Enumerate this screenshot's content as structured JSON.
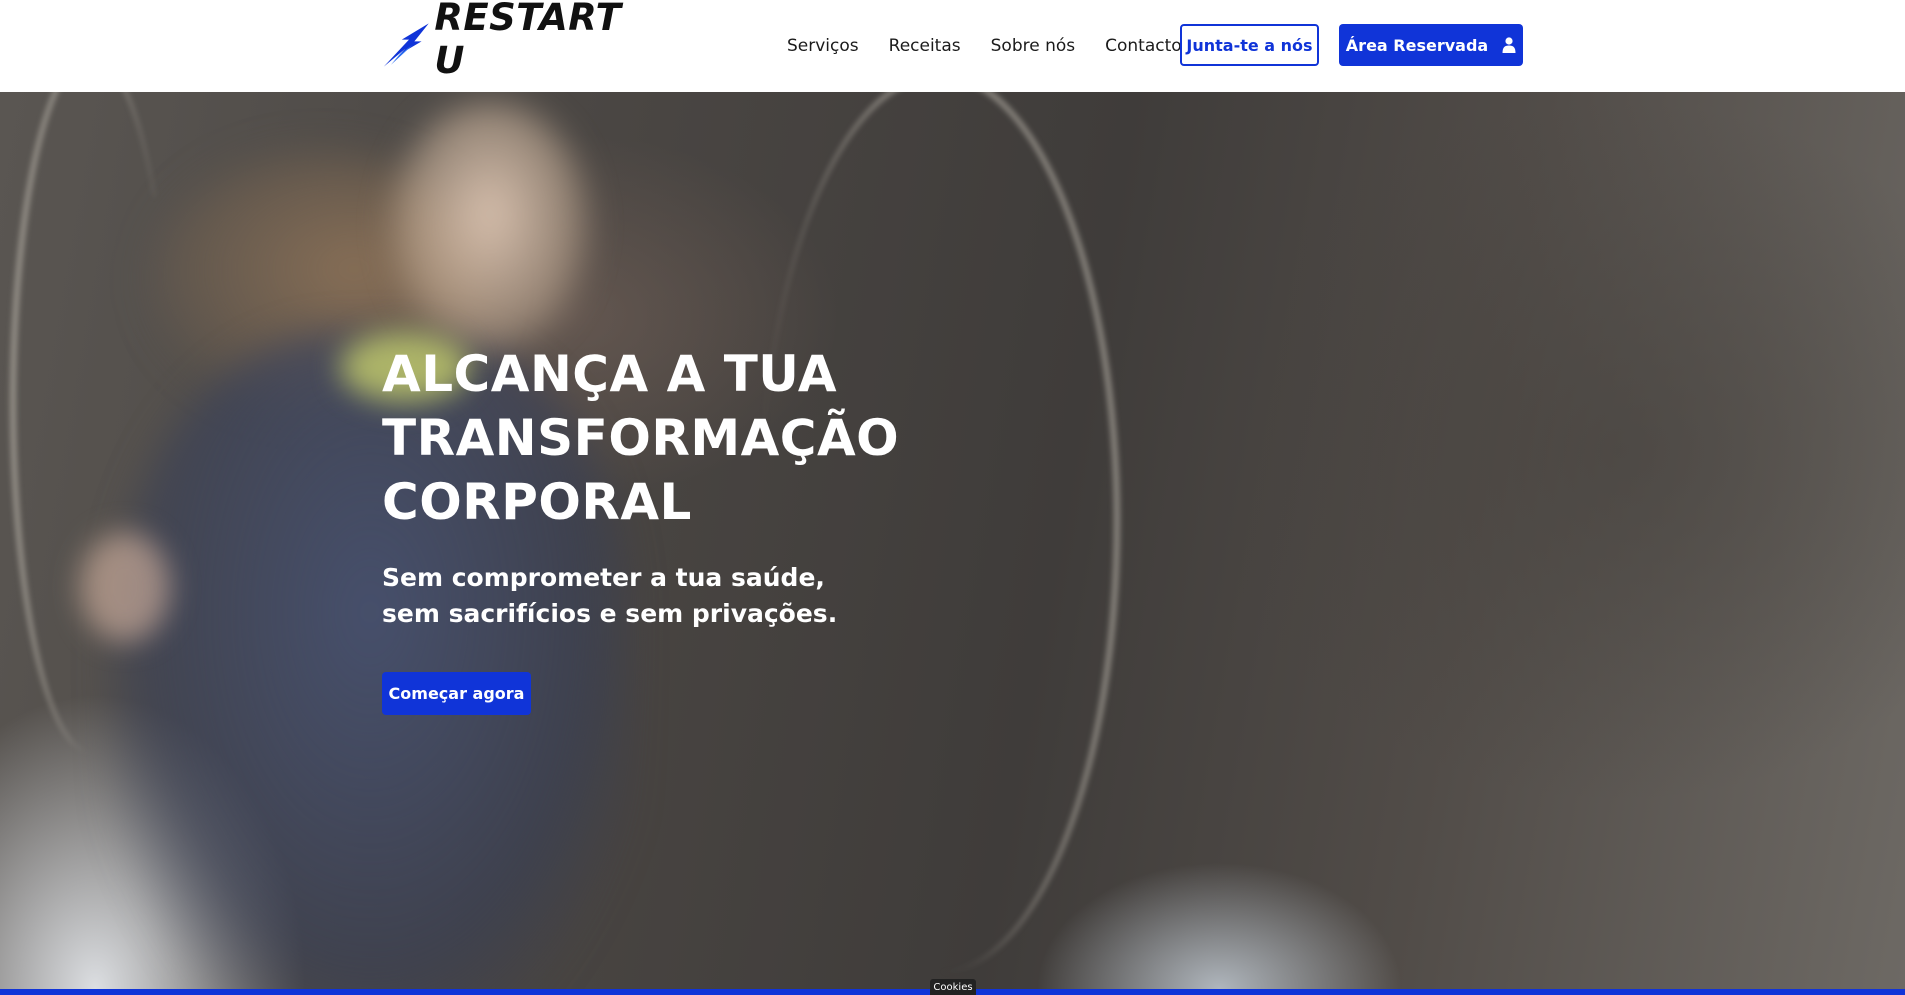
{
  "header": {
    "logo_text": "RESTART U",
    "nav": [
      "Serviços",
      "Receitas",
      "Sobre nós",
      "Contactos"
    ],
    "join_label": "Junta-te a nós",
    "reserved_label": "Área Reservada"
  },
  "hero": {
    "title_lines": [
      "ALCANÇA A TUA",
      "TRANSFORMAÇÃO",
      "CORPORAL"
    ],
    "subtitle_lines": [
      "Sem comprometer a tua saúde,",
      "sem sacrifícios e sem privações."
    ],
    "cta_label": "Começar agora"
  },
  "footer": {
    "cookies_label": "Cookies"
  },
  "colors": {
    "accent": "#1034d8",
    "text_dark": "#1b1b1b",
    "hero_text": "#ffffff"
  },
  "icons": {
    "logo": "lightning-arrow-icon",
    "reserved": "user-icon"
  }
}
